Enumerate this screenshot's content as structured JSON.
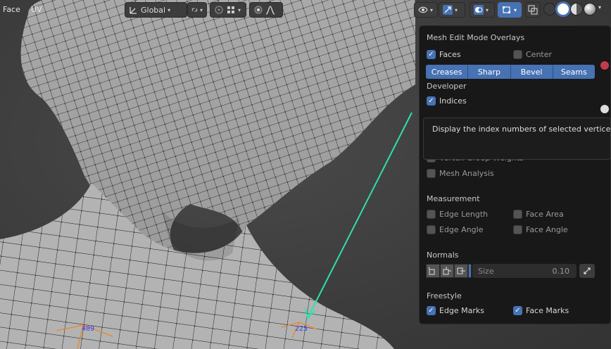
{
  "header": {
    "menu_face": "Face",
    "menu_uv": "UV",
    "orientation": "Global"
  },
  "overlay": {
    "title": "Mesh Edit Mode Overlays",
    "faces_label": "Faces",
    "center_label": "Center",
    "edge_buttons": [
      "Creases",
      "Sharp",
      "Bevel",
      "Seams"
    ],
    "developer_title": "Developer",
    "indices_label": "Indices",
    "vertex_group_weights_label": "Vertex Group Weights",
    "mesh_analysis_label": "Mesh Analysis",
    "measurement_title": "Measurement",
    "edge_length_label": "Edge Length",
    "face_area_label": "Face Area",
    "edge_angle_label": "Edge Angle",
    "face_angle_label": "Face Angle",
    "normals_title": "Normals",
    "size_label": "Size",
    "size_value": "0.10",
    "freestyle_title": "Freestyle",
    "edge_marks_label": "Edge Marks",
    "face_marks_label": "Face Marks"
  },
  "tooltip": {
    "text": "Display the index numbers of selected vertices, e"
  },
  "viewport": {
    "index_labels": [
      "409",
      "225"
    ]
  },
  "colors": {
    "accent": "#4772b3",
    "annotation": "#2de0b0"
  }
}
